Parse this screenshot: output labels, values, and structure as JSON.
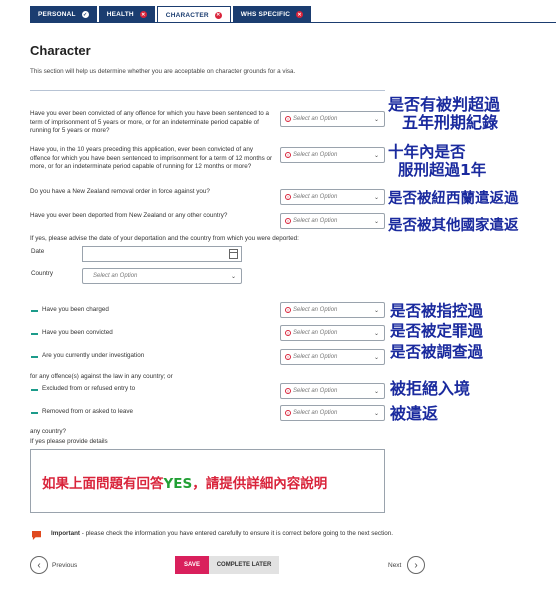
{
  "tabs": [
    {
      "label": "PERSONAL",
      "status": "check"
    },
    {
      "label": "HEALTH",
      "status": "close"
    },
    {
      "label": "CHARACTER",
      "status": "close"
    },
    {
      "label": "WHS SPECIFIC",
      "status": "close"
    }
  ],
  "page_title": "Character",
  "intro": "This section will help us determine whether you are acceptable on character grounds for a visa.",
  "select_placeholder": "Select an Option",
  "questions": {
    "q1": "Have you ever been convicted of any offence for which you have been sentenced to a term of imprisonment of 5 years or more, or for an indeterminate period capable of running for 5 years or more?",
    "q2": "Have you, in the 10 years preceding this application, ever been convicted of any offence for which you have been sentenced to imprisonment for a term of 12 months or more, or for an indeterminate period capable of running for 12 months or more?",
    "q3": "Do you have a New Zealand removal order in force against you?",
    "q4": "Have you ever been deported from New Zealand or any other country?",
    "q4_followup": "If yes, please advise the date of your deportation and the country from which you were deported:",
    "date_label": "Date",
    "country_label": "Country",
    "charged": "Have you been charged",
    "convicted": "Have you been convicted",
    "investigation": "Are you currently under investigation",
    "law_text": "for any offence(s) against the law in any country; or",
    "excluded": "Excluded from or refused entry to",
    "removed": "Removed from or asked to leave",
    "any_country": "any country?",
    "details_label": "If yes please provide details"
  },
  "annotations": {
    "a1_line1": "是否有被判超過",
    "a1_line2": "五年刑期紀錄",
    "a2_line1": "十年內是否",
    "a2_line2": "服刑超過1年",
    "a3": "是否被紐西蘭遣返過",
    "a4": "是否被其他國家遣返",
    "a5": "是否被指控過",
    "a6": "是否被定罪過",
    "a7": "是否被調查過",
    "a8": "被拒絕入境",
    "a9": "被遣返",
    "textarea_note_prefix": "如果上面問題有回答",
    "textarea_note_yes": "YES",
    "textarea_note_suffix": "，請提供詳細內容說明"
  },
  "important_bold": "Important",
  "important_text": " - please check the information you have entered carefully to ensure it is correct before going to the next section.",
  "nav": {
    "previous": "Previous",
    "save": "SAVE",
    "complete_later": "COMPLETE LATER",
    "next": "Next"
  },
  "colors": {
    "tab_bg": "#1b3d70",
    "accent_red": "#d9243b",
    "save_pink": "#d9205c",
    "annotation_blue": "#1a2a9e",
    "teal_dash": "#1c9b8a"
  }
}
